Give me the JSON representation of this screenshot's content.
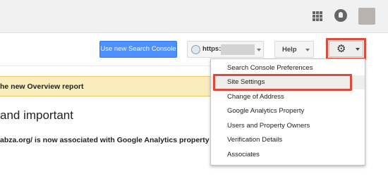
{
  "colors": {
    "accent_blue": "#4d90fe",
    "highlight_red": "#dd4b39",
    "banner_yellow": "#f9edbe"
  },
  "topbar": {
    "apps_icon": "apps-grid-icon",
    "notifications_icon": "notifications-icon",
    "avatar": "user-avatar"
  },
  "toolbar": {
    "new_console_label": "Use new Search Console",
    "site_url": "https:",
    "help_label": "Help",
    "settings_icon": "gear-icon"
  },
  "banner": {
    "text": "he new Overview report"
  },
  "main": {
    "heading": "and important",
    "message": "abza.org/ is now associated with Google Analytics property N"
  },
  "settings_menu": {
    "items": [
      {
        "label": "Search Console Preferences"
      },
      {
        "label": "Site Settings"
      },
      {
        "label": "Change of Address"
      },
      {
        "label": "Google Analytics Property"
      },
      {
        "label": "Users and Property Owners"
      },
      {
        "label": "Verification Details"
      },
      {
        "label": "Associates"
      }
    ]
  }
}
